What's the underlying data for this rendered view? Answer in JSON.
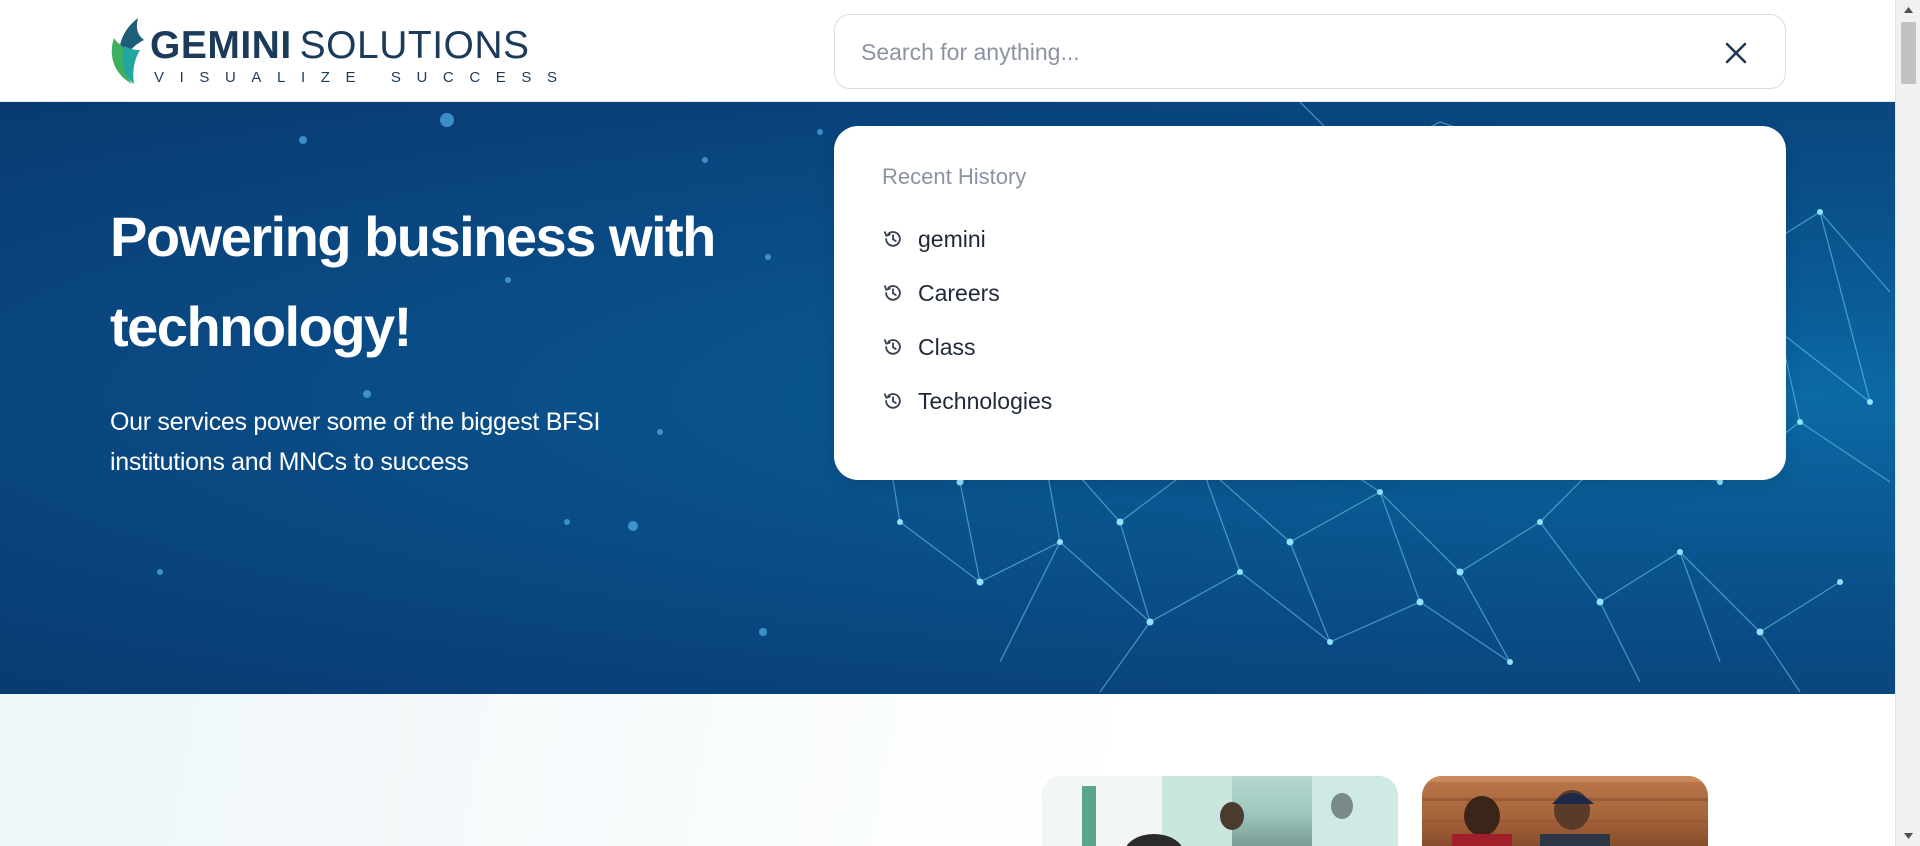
{
  "header": {
    "logo": {
      "name_bold": "GEMINI",
      "name_light": "SOLUTIONS",
      "tagline": "VISUALIZE SUCCESS",
      "colors": {
        "text": "#1c3a5a",
        "leaf_green": "#3fae5f",
        "leaf_teal": "#23a6a0",
        "leaf_dark": "#1d5f7a"
      }
    },
    "search": {
      "placeholder": "Search for anything...",
      "value": "",
      "close_icon": "close-icon"
    }
  },
  "hero": {
    "title": "Powering business with technology!",
    "subtitle": "Our services power some of the biggest BFSI institutions and MNCs to success",
    "background_color": "#0a4a84"
  },
  "search_dropdown": {
    "heading": "Recent History",
    "items": [
      {
        "label": "gemini",
        "icon": "history-icon"
      },
      {
        "label": "Careers",
        "icon": "history-icon"
      },
      {
        "label": "Class",
        "icon": "history-icon"
      },
      {
        "label": "Technologies",
        "icon": "history-icon"
      }
    ]
  },
  "colors": {
    "accent": "#0a4a84",
    "text_dark": "#1f2937",
    "muted": "#8a93a3"
  }
}
